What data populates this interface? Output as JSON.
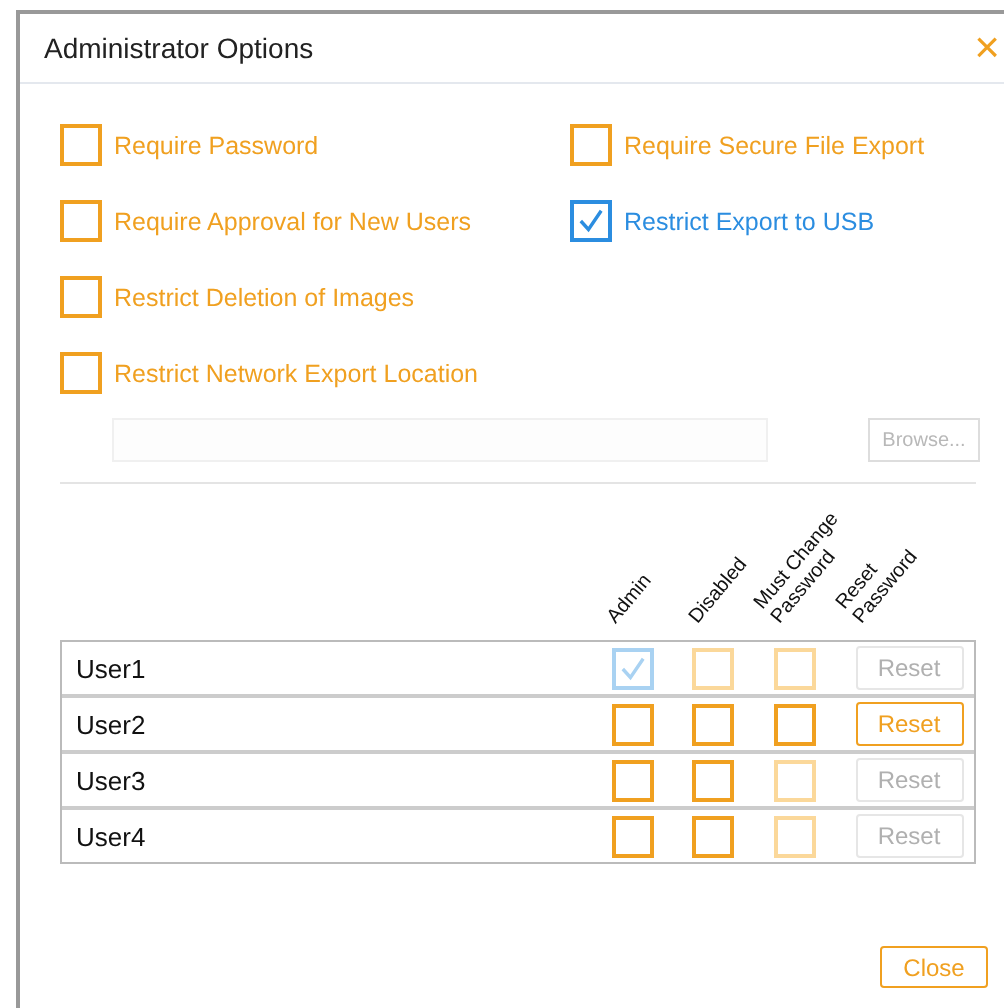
{
  "dialog": {
    "title": "Administrator Options",
    "close_icon": "×"
  },
  "options": [
    {
      "label": "Require Password",
      "checked": false
    },
    {
      "label": "Require Approval for New Users",
      "checked": false
    },
    {
      "label": "Restrict Deletion of Images",
      "checked": false
    },
    {
      "label": "Restrict Network Export Location",
      "checked": false
    },
    {
      "label": "Require Secure File Export",
      "checked": false
    },
    {
      "label": "Restrict Export to USB",
      "checked": true
    }
  ],
  "network_location": {
    "disabled": true,
    "browse_button": "Browse..."
  },
  "table": {
    "columns": [
      "Admin",
      "Disabled",
      "Must Change Password",
      "Reset Password"
    ],
    "rows": [
      {
        "name": "User1",
        "admin": {
          "checked": true,
          "disabled": true
        },
        "disabled": {
          "checked": false,
          "disabled": true
        },
        "must_change": {
          "checked": false,
          "disabled": true
        },
        "reset": {
          "label": "Reset",
          "disabled": true
        }
      },
      {
        "name": "User2",
        "admin": {
          "checked": false,
          "disabled": false
        },
        "disabled": {
          "checked": false,
          "disabled": false
        },
        "must_change": {
          "checked": false,
          "disabled": false
        },
        "reset": {
          "label": "Reset",
          "disabled": false
        }
      },
      {
        "name": "User3",
        "admin": {
          "checked": false,
          "disabled": false
        },
        "disabled": {
          "checked": false,
          "disabled": false
        },
        "must_change": {
          "checked": false,
          "disabled": true
        },
        "reset": {
          "label": "Reset",
          "disabled": true
        }
      },
      {
        "name": "User4",
        "admin": {
          "checked": false,
          "disabled": false
        },
        "disabled": {
          "checked": false,
          "disabled": false
        },
        "must_change": {
          "checked": false,
          "disabled": true
        },
        "reset": {
          "label": "Reset",
          "disabled": true
        }
      }
    ]
  },
  "close_button": "Close"
}
